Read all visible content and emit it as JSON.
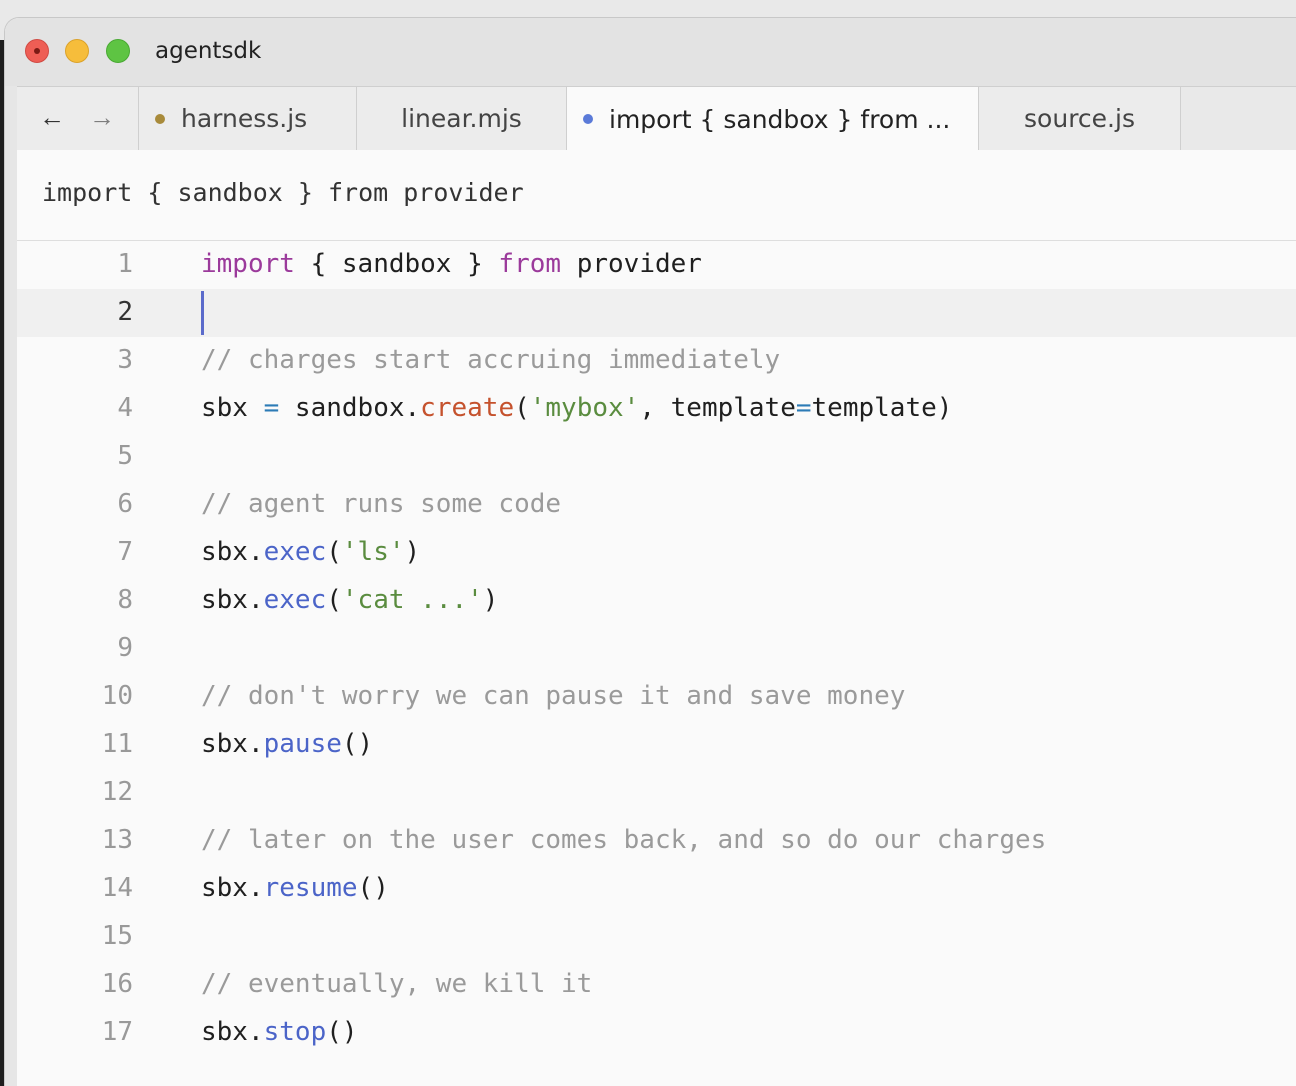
{
  "window": {
    "title": "agentsdk"
  },
  "nav": {
    "back": "←",
    "forward": "→"
  },
  "tabs": [
    {
      "label": "harness.js",
      "modified": true,
      "dot_color": "#a88a3a",
      "active": false
    },
    {
      "label": "linear.mjs",
      "modified": false,
      "active": false
    },
    {
      "label": "import { sandbox } from ...",
      "modified": true,
      "dot_color": "#5a7ad8",
      "active": true
    },
    {
      "label": "source.js",
      "modified": false,
      "active": false
    }
  ],
  "breadcrumb": "import { sandbox } from provider",
  "editor": {
    "current_line": 2,
    "lines": [
      {
        "n": "1",
        "tokens": [
          [
            "kw",
            "import"
          ],
          [
            "",
            "  "
          ],
          [
            "",
            "{ sandbox }"
          ],
          [
            "",
            ""
          ]
        ],
        "text": ""
      },
      {
        "n": "2"
      },
      {
        "n": "3"
      },
      {
        "n": "4"
      },
      {
        "n": "5"
      },
      {
        "n": "6"
      },
      {
        "n": "7"
      },
      {
        "n": "8"
      },
      {
        "n": "9"
      },
      {
        "n": "10"
      },
      {
        "n": "11"
      },
      {
        "n": "12"
      },
      {
        "n": "13"
      },
      {
        "n": "14"
      },
      {
        "n": "15"
      },
      {
        "n": "16"
      },
      {
        "n": "17"
      }
    ],
    "code": {
      "l1_import": "import",
      "l1_mid": " { sandbox } ",
      "l1_from": "from",
      "l1_rest": " provider",
      "l3": "// charges start accruing immediately",
      "l4_a": "sbx ",
      "l4_eq": "=",
      "l4_b": " sandbox.",
      "l4_fn": "create",
      "l4_c": "(",
      "l4_str": "'mybox'",
      "l4_d": ", template",
      "l4_eq2": "=",
      "l4_e": "template)",
      "l6": "// agent runs some code",
      "l7_a": "sbx.",
      "l7_fn": "exec",
      "l7_b": "(",
      "l7_str": "'ls'",
      "l7_c": ")",
      "l8_a": "sbx.",
      "l8_fn": "exec",
      "l8_b": "(",
      "l8_str": "'cat ...'",
      "l8_c": ")",
      "l10": "// don't worry we can pause it and save money",
      "l11_a": "sbx.",
      "l11_fn": "pause",
      "l11_b": "()",
      "l13": "// later on the user comes back, and so do our charges",
      "l14_a": "sbx.",
      "l14_fn": "resume",
      "l14_b": "()",
      "l16": "// eventually, we kill it",
      "l17_a": "sbx.",
      "l17_fn": "stop",
      "l17_b": "()"
    }
  }
}
